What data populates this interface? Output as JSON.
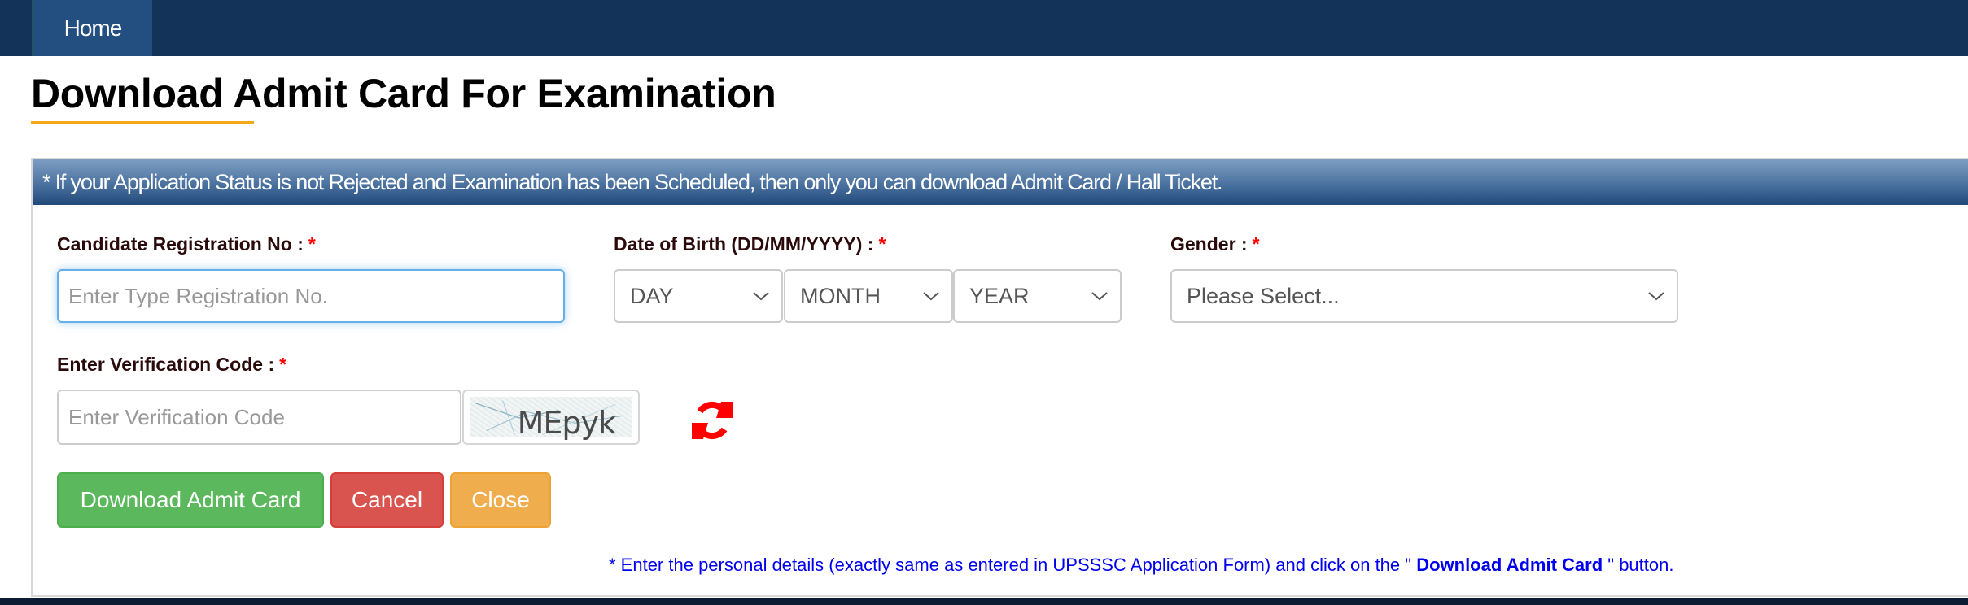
{
  "nav": {
    "items": [
      {
        "label": "Home"
      }
    ]
  },
  "page": {
    "title": "Download Admit Card For Examination"
  },
  "panel": {
    "header_text": "* If your Application Status is not Rejected and Examination has been Scheduled, then only you can download Admit Card / Hall Ticket."
  },
  "form": {
    "registration": {
      "label": "Candidate Registration No :",
      "required_mark": "*",
      "value": "",
      "placeholder": "Enter Type Registration No."
    },
    "dob": {
      "label": "Date of Birth (DD/MM/YYYY) :",
      "required_mark": "*",
      "day": {
        "selected": "DAY"
      },
      "month": {
        "selected": "MONTH"
      },
      "year": {
        "selected": "YEAR"
      }
    },
    "gender": {
      "label": "Gender :",
      "required_mark": "*",
      "selected": "Please Select..."
    },
    "verification": {
      "label": "Enter Verification Code :",
      "required_mark": "*",
      "value": "",
      "placeholder": "Enter Verification Code",
      "captcha_text": "MEpyk",
      "refresh_icon": "refresh-icon"
    }
  },
  "buttons": {
    "download": "Download Admit Card",
    "cancel": "Cancel",
    "close": "Close"
  },
  "note": {
    "prefix": "* Enter the personal details (exactly same as entered in UPSSSC Application Form) and click on the \" ",
    "emphasis": "Download Admit Card",
    "suffix": " \" button."
  },
  "colors": {
    "nav_bg": "#133359",
    "nav_active": "#224f80",
    "title_underline": "#f5a91a",
    "required": "#ff0000",
    "success": "#5cb85c",
    "danger": "#d9534f",
    "warning": "#f0ad4e",
    "note_text": "#0000ee",
    "refresh_icon": "#ff0000"
  }
}
